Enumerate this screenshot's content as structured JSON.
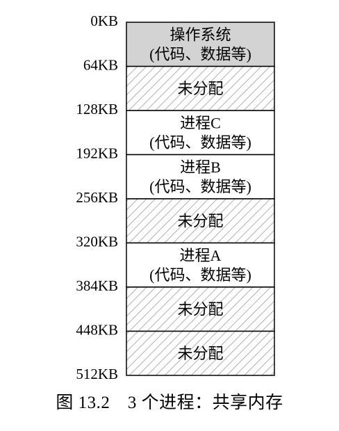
{
  "figure": {
    "caption": "图 13.2　3 个进程：共享内存"
  },
  "memory_map": {
    "address_labels": [
      "0KB",
      "64KB",
      "128KB",
      "192KB",
      "256KB",
      "320KB",
      "384KB",
      "448KB",
      "512KB"
    ],
    "segments": [
      {
        "id": "os",
        "lines": [
          "操作系统",
          "(代码、数据等)"
        ],
        "fill": "gray"
      },
      {
        "id": "free-1",
        "lines": [
          "未分配"
        ],
        "fill": "hatched"
      },
      {
        "id": "process-c",
        "lines": [
          "进程C",
          "(代码、数据等)"
        ],
        "fill": "white"
      },
      {
        "id": "process-b",
        "lines": [
          "进程B",
          "(代码、数据等)"
        ],
        "fill": "white"
      },
      {
        "id": "free-2",
        "lines": [
          "未分配"
        ],
        "fill": "hatched"
      },
      {
        "id": "process-a",
        "lines": [
          "进程A",
          "(代码、数据等)"
        ],
        "fill": "white"
      },
      {
        "id": "free-3",
        "lines": [
          "未分配"
        ],
        "fill": "hatched"
      },
      {
        "id": "free-4",
        "lines": [
          "未分配"
        ],
        "fill": "hatched"
      }
    ]
  },
  "colors": {
    "os_fill": "#d3d3d3",
    "hatch_background": "#ffffff",
    "hatch_line": "#b0b0b0",
    "border": "#000000"
  }
}
